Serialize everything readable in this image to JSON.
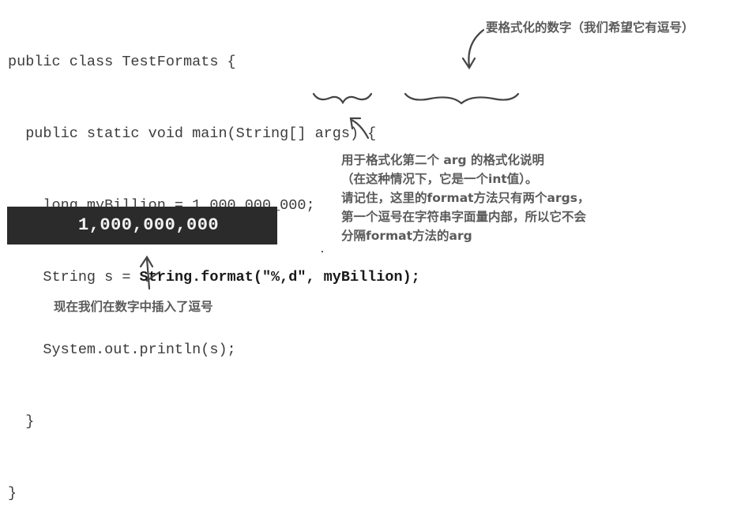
{
  "code": {
    "line1": "public class TestFormats {",
    "line2": "  public static void main(String[] args) {",
    "line3": "    long myBillion = 1_000_000_000;",
    "line4_prefix": "    String s = ",
    "line4_call": "String.format(\"%,d\", myBillion);",
    "line5": "    System.out.println(s);",
    "line6": "  }",
    "line7": "}"
  },
  "output": {
    "value": "1,000,000,000"
  },
  "annotations": {
    "top": "要格式化的数字（我们希望它有逗号）",
    "middle": "用于格式化第二个 arg 的格式化说明\n（在这种情况下，它是一个int值）。\n请记住，这里的format方法只有两个args，\n第一个逗号在字符串字面量内部，所以它不会\n分隔format方法的arg",
    "bottom": "现在我们在数字中插入了逗号"
  }
}
